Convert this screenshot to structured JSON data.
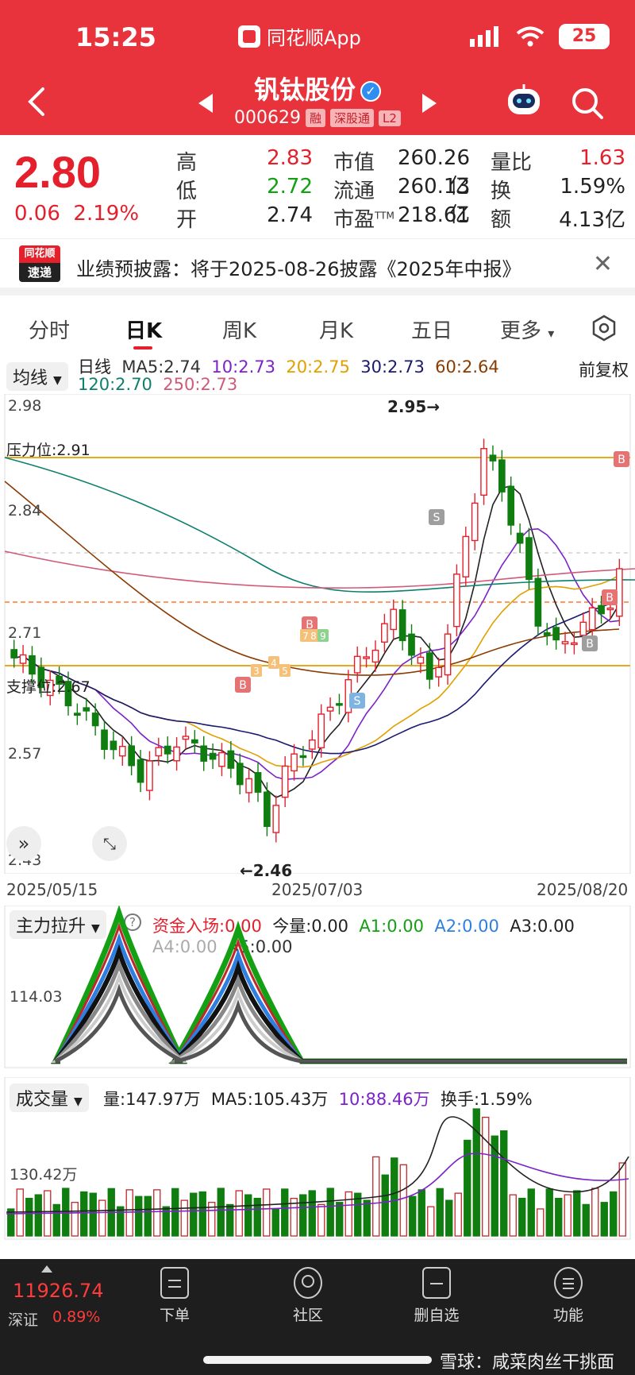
{
  "status": {
    "time": "15:25",
    "app": "同花顺App",
    "battery": "25"
  },
  "stock": {
    "name": "钒钛股份",
    "code": "000629",
    "tags": [
      "融",
      "深股通",
      "L2"
    ]
  },
  "quote": {
    "price": "2.80",
    "change": "0.06",
    "change_pct": "2.19%",
    "high_label": "高",
    "high": "2.83",
    "low_label": "低",
    "low": "2.72",
    "open_label": "开",
    "open": "2.74",
    "mktcap_label": "市值",
    "mktcap": "260.26亿",
    "float_label": "流通",
    "float": "260.13亿",
    "pe_label": "市盈",
    "pe_sup": "TTM",
    "pe": "218.61",
    "volratio_label": "量比",
    "volratio": "1.63",
    "turnover_label": "换",
    "turnover": "1.59%",
    "amount_label": "额",
    "amount": "4.13亿"
  },
  "notice": {
    "logo_top": "同花顺",
    "logo_bottom": "速递",
    "text": "业绩预披露：将于2025-08-26披露《2025年中报》",
    "close": "✕"
  },
  "tabs": [
    "分时",
    "日K",
    "周K",
    "月K",
    "五日",
    "更多"
  ],
  "chart": {
    "indicator_select": "均线",
    "adjust": "前复权",
    "ma_title": "日线",
    "ma": [
      {
        "label": "MA5:2.74",
        "color": "#333333"
      },
      {
        "label": "10:2.73",
        "color": "#7b22c9"
      },
      {
        "label": "20:2.75",
        "color": "#e0a000"
      },
      {
        "label": "30:2.73",
        "color": "#1a1a6e"
      },
      {
        "label": "60:2.64",
        "color": "#8b3a00"
      },
      {
        "label": "120:2.70",
        "color": "#0e7f6e"
      },
      {
        "label": "250:2.73",
        "color": "#d05a78"
      }
    ],
    "y_labels": [
      "2.98",
      "2.84",
      "2.71",
      "2.57",
      "2.43"
    ],
    "resistance_label": "压力位:2.91",
    "support_label": "支撑位:2.67",
    "high_mark": "2.95→",
    "low_mark": "←2.46",
    "dates": [
      "2025/05/15",
      "2025/07/03",
      "2025/08/20"
    ],
    "signals": [
      "B",
      "S",
      "7",
      "8",
      "9",
      "3",
      "4",
      "5",
      "B",
      "S",
      "B",
      "B",
      "B"
    ]
  },
  "chart_data": {
    "type": "candlestick",
    "y_axis_ticks": [
      2.98,
      2.84,
      2.71,
      2.57,
      2.43
    ],
    "resistance": 2.91,
    "support": 2.67,
    "high": 2.95,
    "low": 2.46,
    "x_ticks": [
      "2025/05/15",
      "2025/07/03",
      "2025/08/20"
    ],
    "moving_averages": {
      "MA5": 2.74,
      "MA10": 2.73,
      "MA20": 2.75,
      "MA30": 2.73,
      "MA60": 2.64,
      "MA120": 2.7,
      "MA250": 2.73
    }
  },
  "funds": {
    "select": "主力拉升",
    "help": "?",
    "items": [
      {
        "label": "资金入场:0.00",
        "color": "#e3202b"
      },
      {
        "label": "今量:0.00",
        "color": "#222222"
      },
      {
        "label": "A1:0.00",
        "color": "#13a013"
      },
      {
        "label": "A2:0.00",
        "color": "#2f7fe0"
      },
      {
        "label": "A3:0.00",
        "color": "#222222"
      },
      {
        "label": "A4:0.00",
        "color": "#aaaaaa"
      },
      {
        "label": "A5:0.00",
        "color": "#333333"
      }
    ],
    "y_label": "114.03"
  },
  "volume": {
    "select": "成交量",
    "items": [
      {
        "label": "量:147.97万",
        "color": "#222222"
      },
      {
        "label": "MA5:105.43万",
        "color": "#222222"
      },
      {
        "label": "10:88.46万",
        "color": "#7b22c9"
      },
      {
        "label": "换手:1.59%",
        "color": "#222222"
      }
    ],
    "y_label": "130.42万"
  },
  "bottom_bar": {
    "index_value": "11926.74",
    "index_name": "深证",
    "index_pct": "0.89%",
    "items": [
      "下单",
      "社区",
      "删自选",
      "功能"
    ],
    "watermark": "雪球：咸菜肉丝干挑面"
  }
}
